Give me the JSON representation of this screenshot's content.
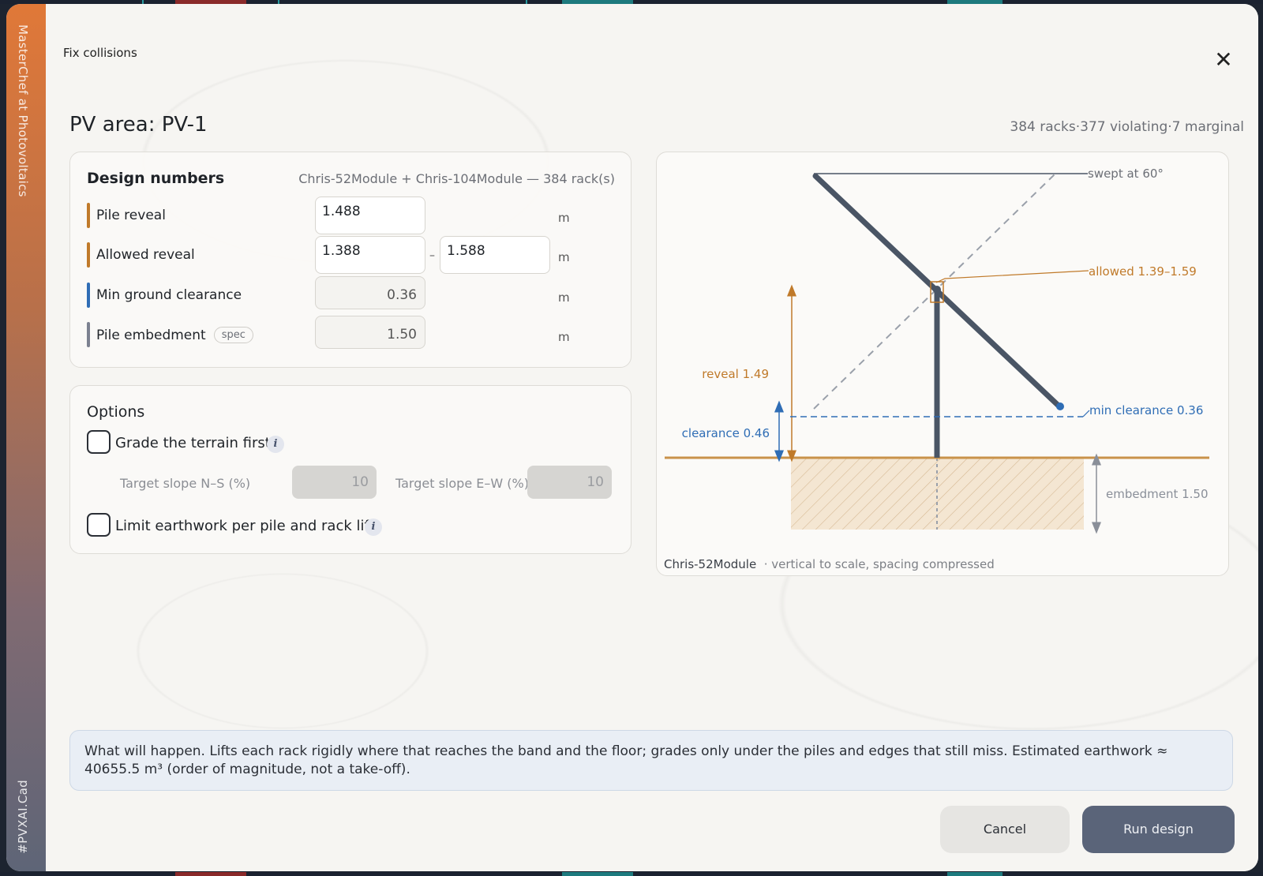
{
  "rail": {
    "top_text": "MasterChef at Photovoltaics",
    "bottom_text": "#PVXAI.Cad"
  },
  "header": {
    "breadcrumb": "Fix collisions",
    "close_icon": "close-icon"
  },
  "page": {
    "title": "PV area: PV-1",
    "summary_racks": "384 racks",
    "summary_violating": "377 violating",
    "summary_marginal": "7 marginal"
  },
  "design": {
    "title": "Design numbers",
    "subtitle": "Chris-52Module + Chris-104Module — 384 rack(s)",
    "rows": [
      {
        "label": "Pile reveal",
        "value": "1.488",
        "unit": "m",
        "color": "#c07a2a"
      },
      {
        "label": "Allowed reveal",
        "min": "1.388",
        "max": "1.588",
        "separator": "–",
        "unit": "m",
        "color": "#c07a2a"
      },
      {
        "label": "Min ground clearance",
        "value": "0.36",
        "unit": "m",
        "color": "#2f6db5"
      },
      {
        "label": "Pile embedment",
        "tag": "spec",
        "value": "1.50",
        "unit": "m",
        "color": "#7c8190"
      }
    ]
  },
  "options": {
    "title": "Options",
    "grade_label": "Grade the terrain first",
    "grade_checked": false,
    "slope_ns_label": "Target slope N–S (%)",
    "slope_ns_value": "10",
    "slope_ew_label": "Target slope E–W (%)",
    "slope_ew_value": "10",
    "limit_label": "Limit earthwork per pile and rack lift",
    "limit_checked": false,
    "info_glyph": "i"
  },
  "diagram": {
    "swept_label": "swept at 60°",
    "allowed_label": "allowed 1.39–1.59",
    "reveal_label": "reveal 1.49",
    "min_clearance_label": "min clearance 0.36",
    "clearance_label": "clearance 0.46",
    "embedment_label": "embedment 1.50",
    "caption_module": "Chris-52Module",
    "caption_note": "· vertical to scale, spacing compressed",
    "colors": {
      "structure": "#4a5565",
      "reveal": "#c07a2a",
      "clearance": "#2f6db5",
      "embedment": "#8a8f99",
      "ground": "#c9924a"
    }
  },
  "note": {
    "text": "What will happen. Lifts each rack rigidly where that reaches the band and the floor; grades only under the piles and edges that still miss. Estimated earthwork ≈ 40655.5 m³ (order of magnitude, not a take-off)."
  },
  "actions": {
    "cancel_label": "Cancel",
    "run_label": "Run design"
  }
}
